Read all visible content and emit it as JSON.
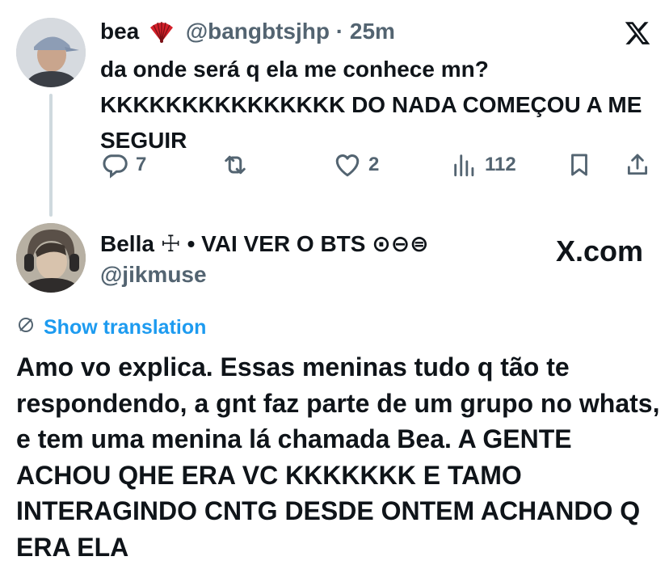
{
  "parent_tweet": {
    "display_name": "bea",
    "handle": "@bangbtsjhp",
    "separator": "·",
    "time": "25m",
    "text": "da onde será q ela me conhece mn? KKKKKKKKKKKKKKK DO NADA COMEÇOU A ME SEGUIR",
    "replies": "7",
    "likes": "2",
    "views": "112"
  },
  "reply_tweet": {
    "display_name": "Bella ☩ • VAI VER O BTS ⊙⊖⊜",
    "handle": "@jikmuse",
    "show_translation": "Show translation",
    "text": "Amo vo explica. Essas meninas tudo q tão te respondendo, a gnt faz parte de um grupo no whats, e tem uma menina lá chamada Bea. A GENTE ACHOU QHE ERA VC KKKKKKK E TAMO INTERAGINDO CNTG DESDE ONTEM ACHANDO Q ERA ELA"
  },
  "watermark": "X.com",
  "colors": {
    "text": "#0f1419",
    "secondary": "#536471",
    "link": "#1d9bf0",
    "thread_line": "#cfd9de"
  },
  "icons": [
    "fan-emoji-icon",
    "x-logo-icon",
    "reply-icon",
    "retweet-icon",
    "like-icon",
    "views-icon",
    "bookmark-icon",
    "share-icon",
    "translate-icon"
  ]
}
